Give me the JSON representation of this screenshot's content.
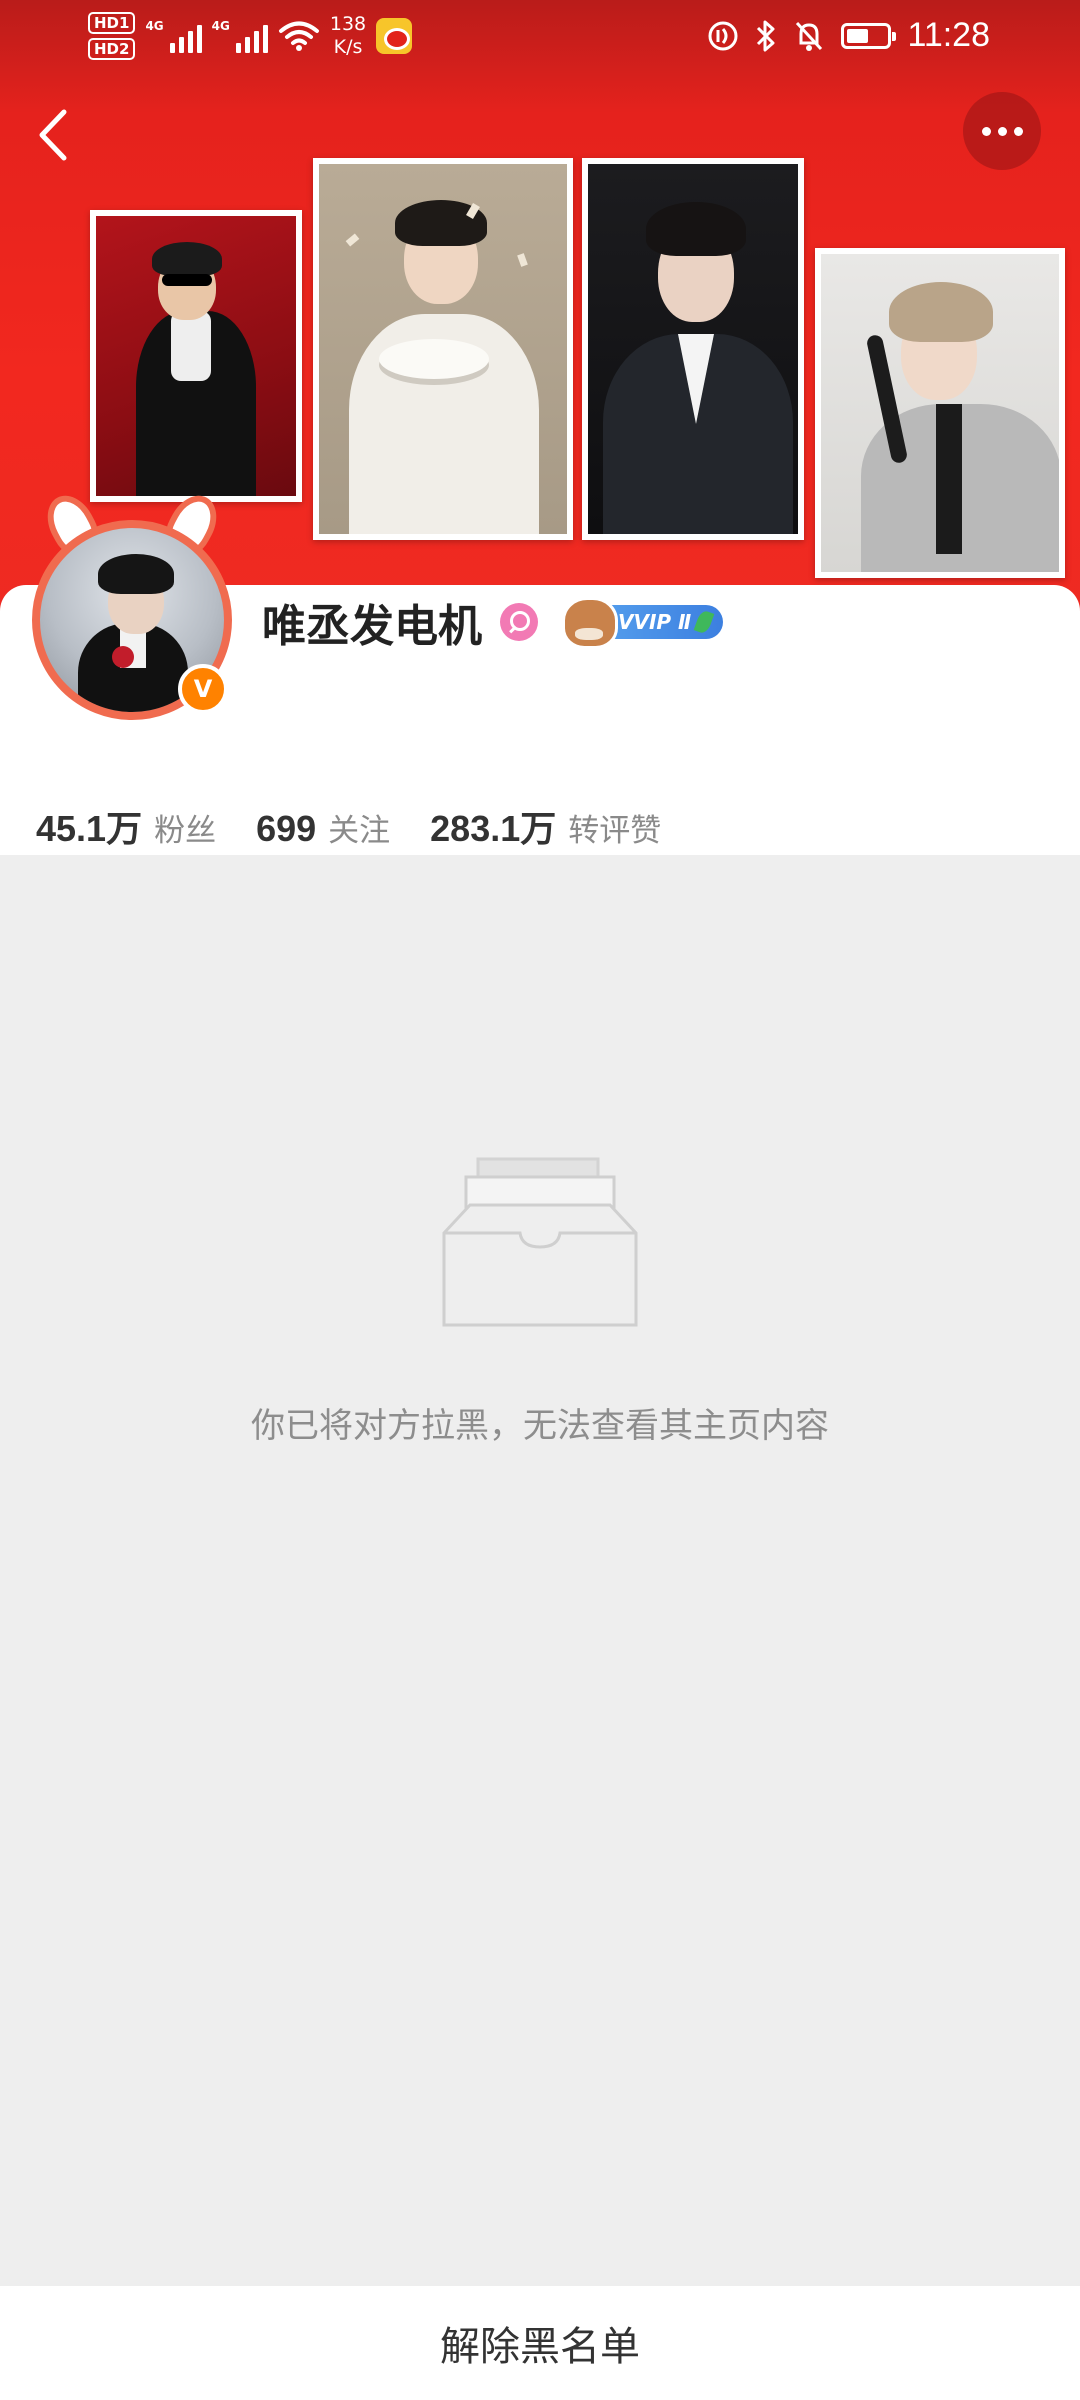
{
  "status_bar": {
    "hd_badges": [
      "HD1",
      "HD2"
    ],
    "network": [
      "4G",
      "4G"
    ],
    "net_speed_value": "138",
    "net_speed_unit": "K/s",
    "time": "11:28",
    "battery_level": 0.55,
    "icons": [
      "hd-icon",
      "signal-icon",
      "wifi-icon",
      "weibo-app-icon",
      "nfc-icon",
      "bluetooth-icon",
      "mute-icon",
      "battery-icon"
    ]
  },
  "header": {
    "back_icon": "chevron-left-icon",
    "more_icon": "more-dots-icon"
  },
  "profile": {
    "username": "唯丞发电机",
    "vip_label": "VVIP Ⅱ",
    "verified_mark": "V",
    "accent_color": "#ff8200"
  },
  "stats": [
    {
      "value": "45.1万",
      "label": "粉丝"
    },
    {
      "value": "699",
      "label": "关注"
    },
    {
      "value": "283.1万",
      "label": "转评赞"
    }
  ],
  "empty_state": {
    "icon": "empty-inbox-icon",
    "message": "你已将对方拉黑，无法查看其主页内容"
  },
  "bottom_action": {
    "label": "解除黑名单"
  }
}
